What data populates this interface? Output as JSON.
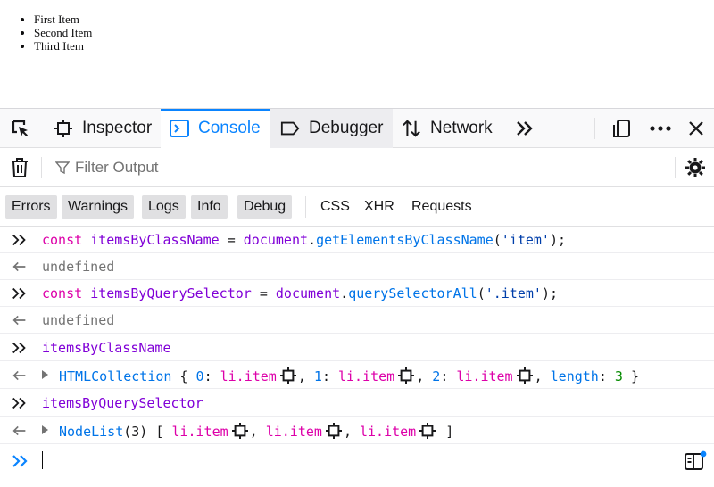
{
  "page": {
    "list_items": [
      "First Item",
      "Second Item",
      "Third Item"
    ]
  },
  "toolbar": {
    "tabs": [
      {
        "label": "Inspector",
        "icon": "inspector-icon"
      },
      {
        "label": "Console",
        "icon": "console-icon",
        "selected": true
      },
      {
        "label": "Debugger",
        "icon": "debugger-icon"
      },
      {
        "label": "Network",
        "icon": "network-icon"
      }
    ]
  },
  "filterbar": {
    "placeholder": "Filter Output"
  },
  "levels": {
    "items": [
      "Errors",
      "Warnings",
      "Logs",
      "Info",
      "Debug"
    ],
    "network": [
      "CSS",
      "XHR",
      "Requests"
    ]
  },
  "console": {
    "rows": [
      {
        "type": "input",
        "parts": [
          [
            "kw",
            "const "
          ],
          [
            "vr",
            "itemsByClassName"
          ],
          [
            "pl",
            " = "
          ],
          [
            "vr",
            "document"
          ],
          [
            "pl",
            "."
          ],
          [
            "fn",
            "getElementsByClassName"
          ],
          [
            "pl",
            "("
          ],
          [
            "st",
            "'item'"
          ],
          [
            "pl",
            ");"
          ]
        ]
      },
      {
        "type": "result",
        "parts": [
          [
            "gy",
            "undefined"
          ]
        ]
      },
      {
        "type": "input",
        "parts": [
          [
            "kw",
            "const "
          ],
          [
            "vr",
            "itemsByQuerySelector"
          ],
          [
            "pl",
            " = "
          ],
          [
            "vr",
            "document"
          ],
          [
            "pl",
            "."
          ],
          [
            "fn",
            "querySelectorAll"
          ],
          [
            "pl",
            "("
          ],
          [
            "st",
            "'.item'"
          ],
          [
            "pl",
            ");"
          ]
        ]
      },
      {
        "type": "result",
        "parts": [
          [
            "gy",
            "undefined"
          ]
        ]
      },
      {
        "type": "input",
        "parts": [
          [
            "vr",
            "itemsByClassName"
          ]
        ]
      },
      {
        "type": "object",
        "parts": [
          [
            "ty",
            "HTMLCollection"
          ],
          [
            "pl",
            " { "
          ],
          [
            "lb",
            "0"
          ],
          [
            "pl",
            ": "
          ],
          [
            "tg",
            "li.item"
          ],
          [
            "node",
            ""
          ],
          [
            "pl",
            ", "
          ],
          [
            "lb",
            "1"
          ],
          [
            "pl",
            ": "
          ],
          [
            "tg",
            "li.item"
          ],
          [
            "node",
            ""
          ],
          [
            "pl",
            ", "
          ],
          [
            "lb",
            "2"
          ],
          [
            "pl",
            ": "
          ],
          [
            "tg",
            "li.item"
          ],
          [
            "node",
            ""
          ],
          [
            "pl",
            ", "
          ],
          [
            "lb",
            "length"
          ],
          [
            "pl",
            ": "
          ],
          [
            "nm",
            "3"
          ],
          [
            "pl",
            " }"
          ]
        ]
      },
      {
        "type": "input",
        "parts": [
          [
            "vr",
            "itemsByQuerySelector"
          ]
        ]
      },
      {
        "type": "object",
        "parts": [
          [
            "ty",
            "NodeList"
          ],
          [
            "pl",
            "(3) [ "
          ],
          [
            "tg",
            "li.item"
          ],
          [
            "node",
            ""
          ],
          [
            "pl",
            ", "
          ],
          [
            "tg",
            "li.item"
          ],
          [
            "node",
            ""
          ],
          [
            "pl",
            ", "
          ],
          [
            "tg",
            "li.item"
          ],
          [
            "node",
            ""
          ],
          [
            "pl",
            " ]"
          ]
        ]
      }
    ]
  },
  "colors": {
    "accent": "#0a84ff",
    "keyword": "#dd00a9",
    "variable": "#8000d7",
    "function": "#0074e8",
    "string": "#003eaa",
    "number": "#058b00"
  }
}
